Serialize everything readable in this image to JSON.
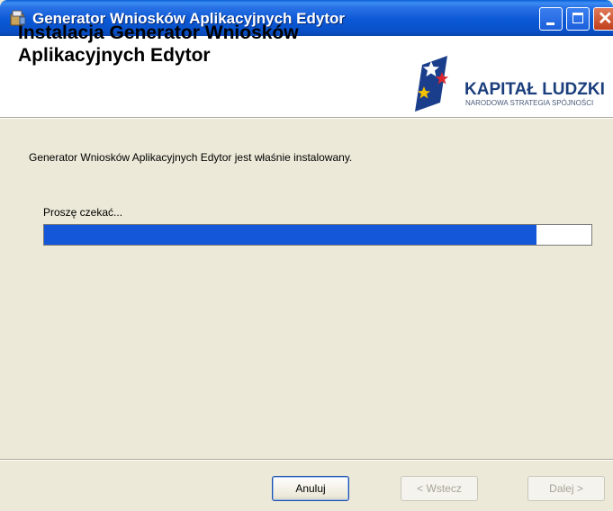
{
  "window": {
    "title": "Generator Wniosków Aplikacyjnych Edytor"
  },
  "header": {
    "title": "Instalacja Generator Wniosków Aplikacyjnych Edytor",
    "logo_name": "KAPITAŁ LUDZKI",
    "logo_subtitle": "NARODOWA STRATEGIA SPÓJNOŚCI"
  },
  "body": {
    "status": "Generator Wniosków Aplikacyjnych Edytor jest właśnie instalowany.",
    "progress_label": "Proszę czekać...",
    "progress_fraction": 0.9
  },
  "footer": {
    "cancel_label": "Anuluj",
    "back_label": "< Wstecz",
    "next_label": "Dalej >"
  },
  "colors": {
    "progress": "#1457d8",
    "titlebar": "#0a58d6"
  }
}
